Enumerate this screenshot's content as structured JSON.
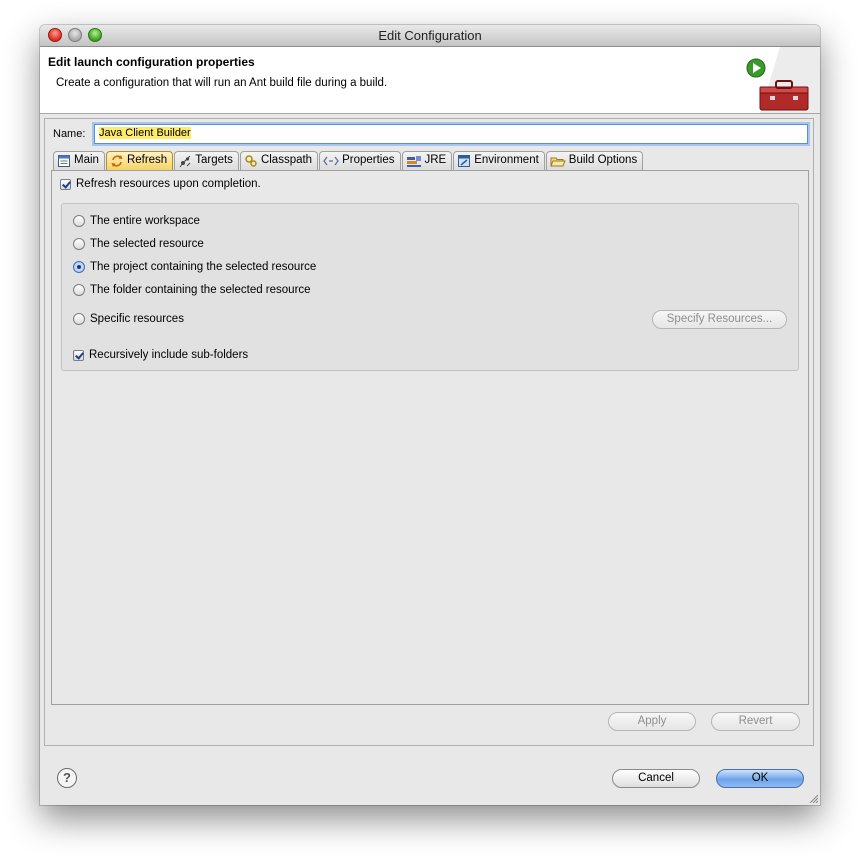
{
  "window": {
    "title": "Edit Configuration"
  },
  "banner": {
    "title": "Edit launch configuration properties",
    "message": "Create a configuration that will run an Ant build file during a build."
  },
  "name_field": {
    "label": "Name:",
    "value": "Java Client Builder"
  },
  "tabs": [
    {
      "label": "Main",
      "icon": "main-tab-icon",
      "active": false
    },
    {
      "label": "Refresh",
      "icon": "refresh-icon",
      "active": true
    },
    {
      "label": "Targets",
      "icon": "targets-icon",
      "active": false
    },
    {
      "label": "Classpath",
      "icon": "classpath-icon",
      "active": false
    },
    {
      "label": "Properties",
      "icon": "properties-icon",
      "active": false
    },
    {
      "label": "JRE",
      "icon": "jre-icon",
      "active": false
    },
    {
      "label": "Environment",
      "icon": "environment-icon",
      "active": false
    },
    {
      "label": "Build Options",
      "icon": "build-options-icon",
      "active": false
    }
  ],
  "refresh": {
    "refresh_upon_completion": {
      "label": "Refresh resources upon completion.",
      "checked": true
    },
    "scope_options": [
      {
        "label": "The entire workspace",
        "selected": false
      },
      {
        "label": "The selected resource",
        "selected": false
      },
      {
        "label": "The project containing the selected resource",
        "selected": true
      },
      {
        "label": "The folder containing the selected resource",
        "selected": false
      },
      {
        "label": "Specific resources",
        "selected": false
      }
    ],
    "specify_resources_label": "Specify Resources...",
    "recursive": {
      "label": "Recursively include sub-folders",
      "checked": true
    }
  },
  "buttons": {
    "apply": "Apply",
    "revert": "Revert",
    "cancel": "Cancel",
    "ok": "OK",
    "help": "?"
  },
  "colors": {
    "active_tab": "#f5cf62",
    "focus_ring": "#a6c6ef",
    "name_highlight": "#ffeb6b",
    "primary_button": "#6fa3ea"
  }
}
